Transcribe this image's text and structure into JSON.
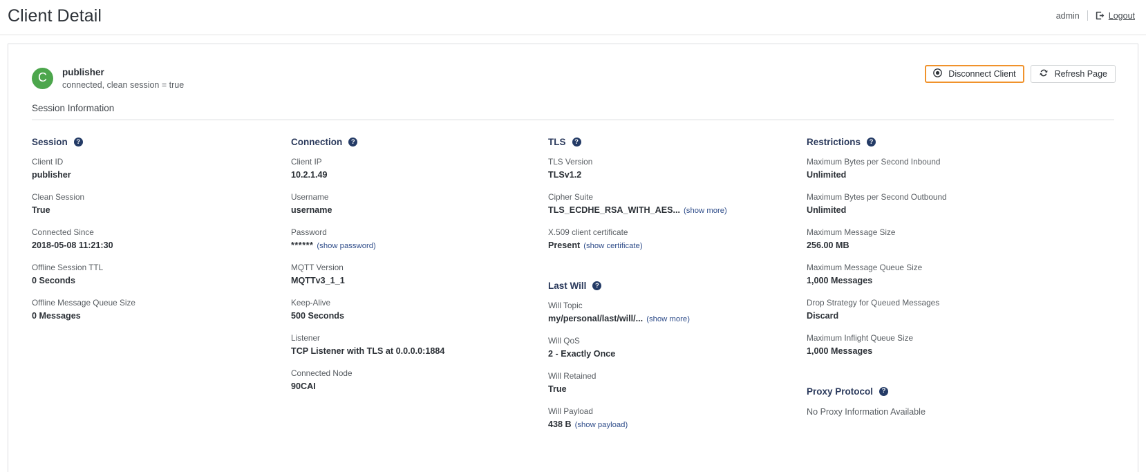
{
  "header": {
    "title": "Client Detail",
    "user": "admin",
    "logout_label": "Logout",
    "logout_icon": "logout-arrow-icon"
  },
  "client": {
    "avatar_letter": "C",
    "name": "publisher",
    "status": "connected, clean session = true"
  },
  "actions": {
    "disconnect_label": "Disconnect Client",
    "disconnect_icon": "power-circle-icon",
    "refresh_label": "Refresh Page",
    "refresh_icon": "refresh-icon",
    "accent_orange": "#f0922b"
  },
  "section": {
    "title": "Session Information"
  },
  "groups": {
    "session": {
      "title": "Session",
      "fields": [
        {
          "label": "Client ID",
          "value": "publisher"
        },
        {
          "label": "Clean Session",
          "value": "True"
        },
        {
          "label": "Connected Since",
          "value": "2018-05-08 11:21:30"
        },
        {
          "label": "Offline Session TTL",
          "value": "0 Seconds"
        },
        {
          "label": "Offline Message Queue Size",
          "value": "0 Messages"
        }
      ]
    },
    "connection": {
      "title": "Connection",
      "fields": [
        {
          "label": "Client IP",
          "value": "10.2.1.49"
        },
        {
          "label": "Username",
          "value": "username"
        },
        {
          "label": "Password",
          "value": "******",
          "link": "(show password)"
        },
        {
          "label": "MQTT Version",
          "value": "MQTTv3_1_1"
        },
        {
          "label": "Keep-Alive",
          "value": "500 Seconds"
        },
        {
          "label": "Listener",
          "value": "TCP Listener with TLS at 0.0.0.0:1884"
        },
        {
          "label": "Connected Node",
          "value": "90CAI"
        }
      ]
    },
    "tls": {
      "title": "TLS",
      "fields": [
        {
          "label": "TLS Version",
          "value": "TLSv1.2"
        },
        {
          "label": "Cipher Suite",
          "value": "TLS_ECDHE_RSA_WITH_AES...",
          "link": "(show more)"
        },
        {
          "label": "X.509 client certificate",
          "value": "Present",
          "link": "(show certificate)"
        }
      ]
    },
    "last_will": {
      "title": "Last Will",
      "fields": [
        {
          "label": "Will Topic",
          "value": "my/personal/last/will/...",
          "link": "(show more)"
        },
        {
          "label": "Will QoS",
          "value": "2 - Exactly Once"
        },
        {
          "label": "Will Retained",
          "value": "True"
        },
        {
          "label": "Will Payload",
          "value": "438 B",
          "link": "(show payload)"
        }
      ]
    },
    "restrictions": {
      "title": "Restrictions",
      "fields": [
        {
          "label": "Maximum Bytes per Second Inbound",
          "value": "Unlimited"
        },
        {
          "label": "Maximum Bytes per Second Outbound",
          "value": "Unlimited"
        },
        {
          "label": "Maximum Message Size",
          "value": "256.00 MB"
        },
        {
          "label": "Maximum Message Queue Size",
          "value": "1,000 Messages"
        },
        {
          "label": "Drop Strategy for Queued Messages",
          "value": "Discard"
        },
        {
          "label": "Maximum Inflight Queue Size",
          "value": "1,000 Messages"
        }
      ]
    },
    "proxy_protocol": {
      "title": "Proxy Protocol",
      "empty_text": "No Proxy Information Available"
    }
  }
}
